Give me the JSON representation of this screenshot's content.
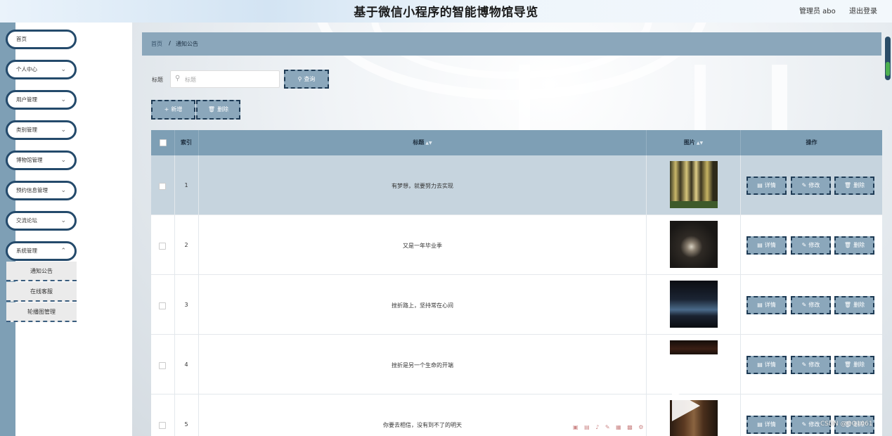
{
  "header": {
    "title": "基于微信小程序的智能博物馆导览",
    "user": "管理员 abo",
    "logout": "退出登录"
  },
  "sidebar": {
    "items": [
      {
        "label": "首页",
        "has_children": false
      },
      {
        "label": "个人中心",
        "has_children": true
      },
      {
        "label": "用户管理",
        "has_children": true
      },
      {
        "label": "类别管理",
        "has_children": true
      },
      {
        "label": "博物馆管理",
        "has_children": true
      },
      {
        "label": "预约信息管理",
        "has_children": true
      },
      {
        "label": "交流论坛",
        "has_children": true
      },
      {
        "label": "系统管理",
        "has_children": true
      }
    ],
    "sub_items": [
      "通知公告",
      "在线客服",
      "轮播图管理"
    ]
  },
  "breadcrumb": {
    "home": "首页",
    "separator": "/",
    "current": "通知公告"
  },
  "search": {
    "label": "标题",
    "placeholder": "标题",
    "button": "查询"
  },
  "toolbar": {
    "add": "新增",
    "delete": "删除"
  },
  "table": {
    "columns": [
      "索引",
      "标题",
      "图片",
      "操作"
    ],
    "actions": {
      "detail": "详情",
      "edit": "修改",
      "delete": "删除"
    },
    "rows": [
      {
        "index": "1",
        "title": "有梦想，就要努力去实现",
        "image": "museum-hall-gold"
      },
      {
        "index": "2",
        "title": "又是一年毕业季",
        "image": "museum-exhibit-dark"
      },
      {
        "index": "3",
        "title": "挫折路上，坚持常在心间",
        "image": "museum-display-blue"
      },
      {
        "index": "4",
        "title": "挫折是另一个生命的开端",
        "image": "museum-banner-partial"
      },
      {
        "index": "5",
        "title": "你要去相信，没有到不了的明天",
        "image": "museum-corridor"
      }
    ]
  },
  "watermark": "CSDN @QQ1061",
  "colors": {
    "accent": "#8ba7bb",
    "dark_border": "#1e3b55",
    "header_row": "#7e9fb5",
    "selected_row": "#c6d4de"
  }
}
